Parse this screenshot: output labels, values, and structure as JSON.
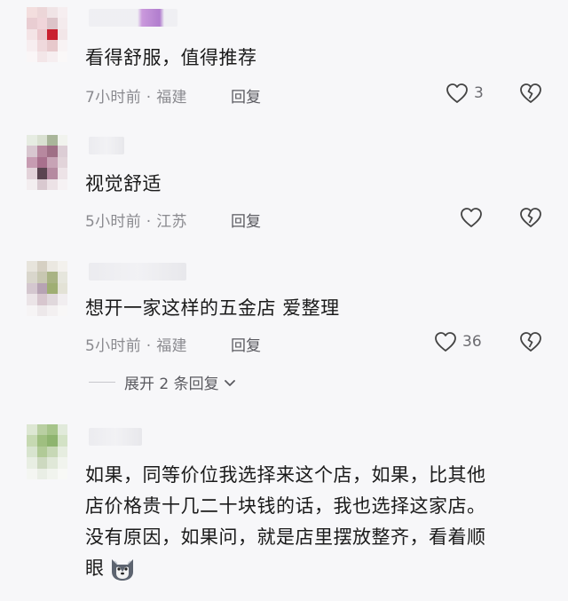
{
  "comments": [
    {
      "text": "看得舒服，值得推荐",
      "time": "7小时前",
      "location": "福建",
      "reply_label": "回复",
      "likes": "3"
    },
    {
      "text": "视觉舒适",
      "time": "5小时前",
      "location": "江苏",
      "reply_label": "回复",
      "likes": ""
    },
    {
      "text": "想开一家这样的五金店 爱整理",
      "time": "5小时前",
      "location": "福建",
      "reply_label": "回复",
      "likes": "36",
      "expand_label": "展开 2 条回复"
    },
    {
      "text_lines": [
        "如果，同等价位我选择来这个店，如果，比其他",
        "店价格贵十几二十块钱的话，我也选择这家店。",
        "没有原因，如果问，就是店里摆放整齐，看着顺",
        "眼"
      ]
    }
  ],
  "meta_separator": "·",
  "icons": {
    "like": "heart-outline-icon",
    "dislike": "broken-heart-icon",
    "expand": "chevron-down-icon",
    "emoji": "husky-emoji-icon"
  },
  "colors": {
    "text": "#1a1a1a",
    "meta": "#8a8a8f",
    "background": "#f7f7f9"
  }
}
